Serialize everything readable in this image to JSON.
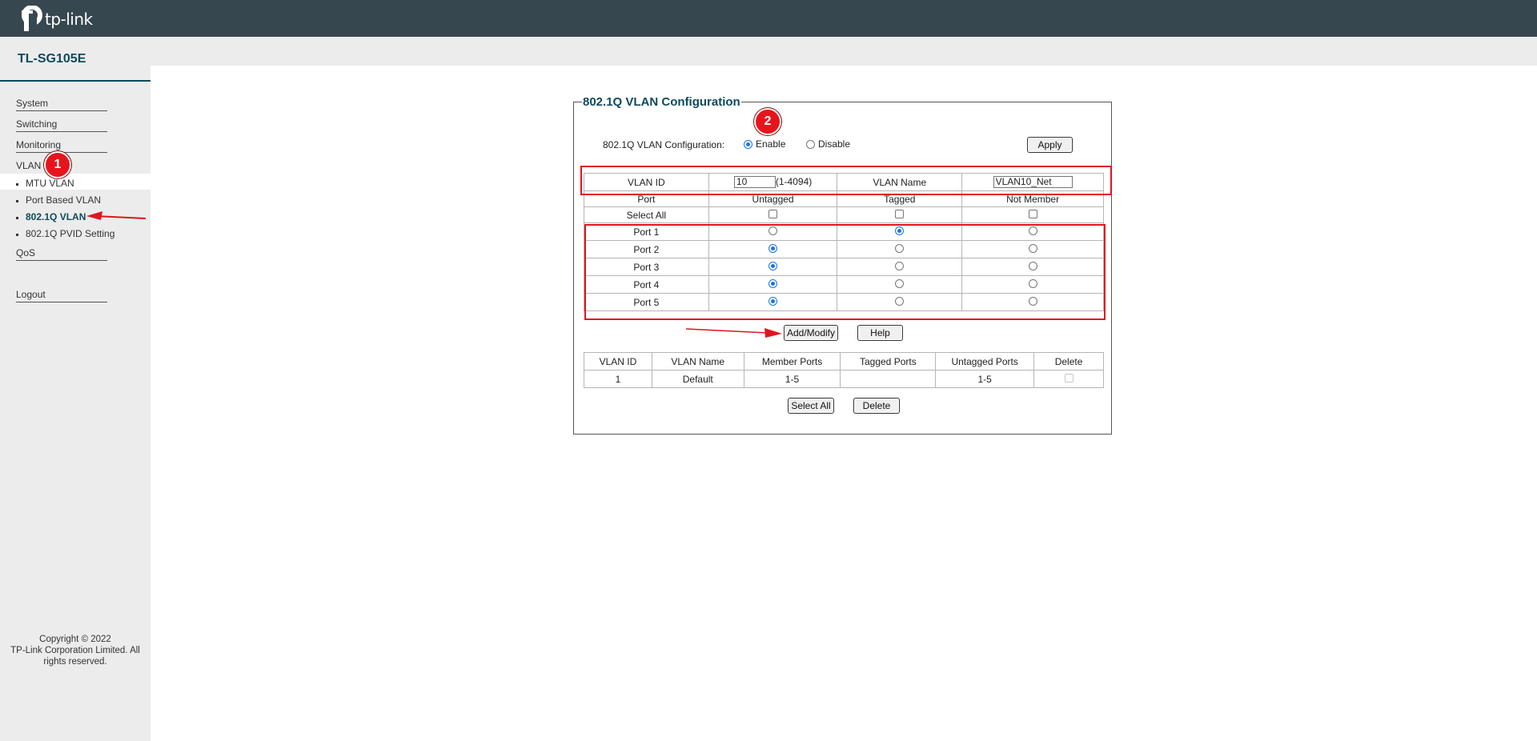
{
  "brand": {
    "logo_text": "tp-link",
    "model": "TL-SG105E",
    "accent": "#0d4a5c",
    "topbar_color": "#37474f"
  },
  "sidebar": {
    "menu": [
      {
        "label": "System"
      },
      {
        "label": "Switching"
      },
      {
        "label": "Monitoring"
      },
      {
        "label": "VLAN"
      }
    ],
    "vlan_subitems": [
      {
        "label": "MTU VLAN"
      },
      {
        "label": "Port Based VLAN"
      },
      {
        "label": "802.1Q VLAN",
        "active": true
      },
      {
        "label": "802.1Q PVID Setting"
      }
    ],
    "qos_label": "QoS",
    "logout_label": "Logout",
    "copyright_line1": "Copyright © 2022",
    "copyright_line2": "TP-Link Corporation Limited. All",
    "copyright_line3": "rights reserved."
  },
  "annotations": {
    "badge1": "1",
    "badge2": "2",
    "annotation_color": "#e0141e"
  },
  "config": {
    "title": "802.1Q VLAN Configuration",
    "mode_label": "802.1Q VLAN Configuration:",
    "enable_label": "Enable",
    "disable_label": "Disable",
    "mode_selected": "Enable",
    "apply_label": "Apply"
  },
  "edit": {
    "vlan_id_label": "VLAN ID",
    "vlan_id_value": "10",
    "vlan_id_range": "(1-4094)",
    "vlan_name_label": "VLAN Name",
    "vlan_name_value": "VLAN10_Net",
    "col_port": "Port",
    "col_untagged": "Untagged",
    "col_tagged": "Tagged",
    "col_not_member": "Not Member",
    "select_all_label": "Select All",
    "ports": [
      {
        "name": "Port 1",
        "mode": "Tagged"
      },
      {
        "name": "Port 2",
        "mode": "Untagged"
      },
      {
        "name": "Port 3",
        "mode": "Untagged"
      },
      {
        "name": "Port 4",
        "mode": "Untagged"
      },
      {
        "name": "Port 5",
        "mode": "Untagged"
      }
    ],
    "add_modify_label": "Add/Modify",
    "help_label": "Help"
  },
  "vlan_table": {
    "headers": [
      "VLAN ID",
      "VLAN Name",
      "Member Ports",
      "Tagged Ports",
      "Untagged Ports",
      "Delete"
    ],
    "rows": [
      {
        "vlan_id": "1",
        "vlan_name": "Default",
        "member_ports": "1-5",
        "tagged_ports": "",
        "untagged_ports": "1-5",
        "delete_checked": false,
        "delete_disabled": true
      }
    ],
    "select_all_label": "Select All",
    "delete_label": "Delete"
  }
}
